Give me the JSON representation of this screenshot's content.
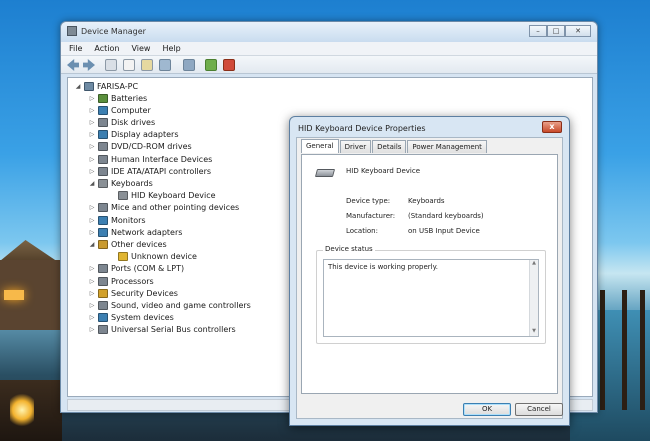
{
  "window": {
    "title": "Device Manager",
    "minimize": "–",
    "maximize": "□",
    "close": "✕"
  },
  "menu": [
    "File",
    "Action",
    "View",
    "Help"
  ],
  "tree": {
    "root": "FARISA-PC",
    "items": [
      {
        "label": "Batteries",
        "expanded": false,
        "icon": "battery-icon",
        "color": "#5a8f3c"
      },
      {
        "label": "Computer",
        "expanded": false,
        "icon": "computer-icon",
        "color": "#3c7fb1"
      },
      {
        "label": "Disk drives",
        "expanded": false,
        "icon": "disk-icon",
        "color": "#7d8690"
      },
      {
        "label": "Display adapters",
        "expanded": false,
        "icon": "display-icon",
        "color": "#3c7fb1"
      },
      {
        "label": "DVD/CD-ROM drives",
        "expanded": false,
        "icon": "dvd-icon",
        "color": "#7d8690"
      },
      {
        "label": "Human Interface Devices",
        "expanded": false,
        "icon": "hid-icon",
        "color": "#7d8690"
      },
      {
        "label": "IDE ATA/ATAPI controllers",
        "expanded": false,
        "icon": "ide-icon",
        "color": "#7d8690"
      },
      {
        "label": "Keyboards",
        "expanded": true,
        "icon": "keyboard-icon",
        "color": "#8a9096"
      },
      {
        "label": "HID Keyboard Device",
        "child": true,
        "icon": "keyboard-icon",
        "color": "#8a9096"
      },
      {
        "label": "Mice and other pointing devices",
        "expanded": false,
        "icon": "mouse-icon",
        "color": "#7d8690"
      },
      {
        "label": "Monitors",
        "expanded": false,
        "icon": "monitor-icon",
        "color": "#3c7fb1"
      },
      {
        "label": "Network adapters",
        "expanded": false,
        "icon": "network-icon",
        "color": "#3c7fb1"
      },
      {
        "label": "Other devices",
        "expanded": true,
        "icon": "other-devices-icon",
        "color": "#c99a2e"
      },
      {
        "label": "Unknown device",
        "child": true,
        "icon": "warning-icon",
        "color": "#e0b531"
      },
      {
        "label": "Ports (COM & LPT)",
        "expanded": false,
        "icon": "port-icon",
        "color": "#7d8690"
      },
      {
        "label": "Processors",
        "expanded": false,
        "icon": "processor-icon",
        "color": "#7d8690"
      },
      {
        "label": "Security Devices",
        "expanded": false,
        "icon": "security-icon",
        "color": "#d2a12b"
      },
      {
        "label": "Sound, video and game controllers",
        "expanded": false,
        "icon": "sound-icon",
        "color": "#7d8690"
      },
      {
        "label": "System devices",
        "expanded": false,
        "icon": "system-icon",
        "color": "#3c7fb1"
      },
      {
        "label": "Universal Serial Bus controllers",
        "expanded": false,
        "icon": "usb-icon",
        "color": "#7d8690"
      }
    ]
  },
  "dialog": {
    "title": "HID Keyboard Device Properties",
    "close": "x",
    "tabs": [
      "General",
      "Driver",
      "Details",
      "Power Management"
    ],
    "device_name": "HID Keyboard Device",
    "properties": [
      {
        "key": "Device type:",
        "value": "Keyboards"
      },
      {
        "key": "Manufacturer:",
        "value": "(Standard keyboards)"
      },
      {
        "key": "Location:",
        "value": "on USB Input Device"
      }
    ],
    "status_label": "Device status",
    "status_text": "This device is working properly.",
    "ok": "OK",
    "cancel": "Cancel"
  }
}
